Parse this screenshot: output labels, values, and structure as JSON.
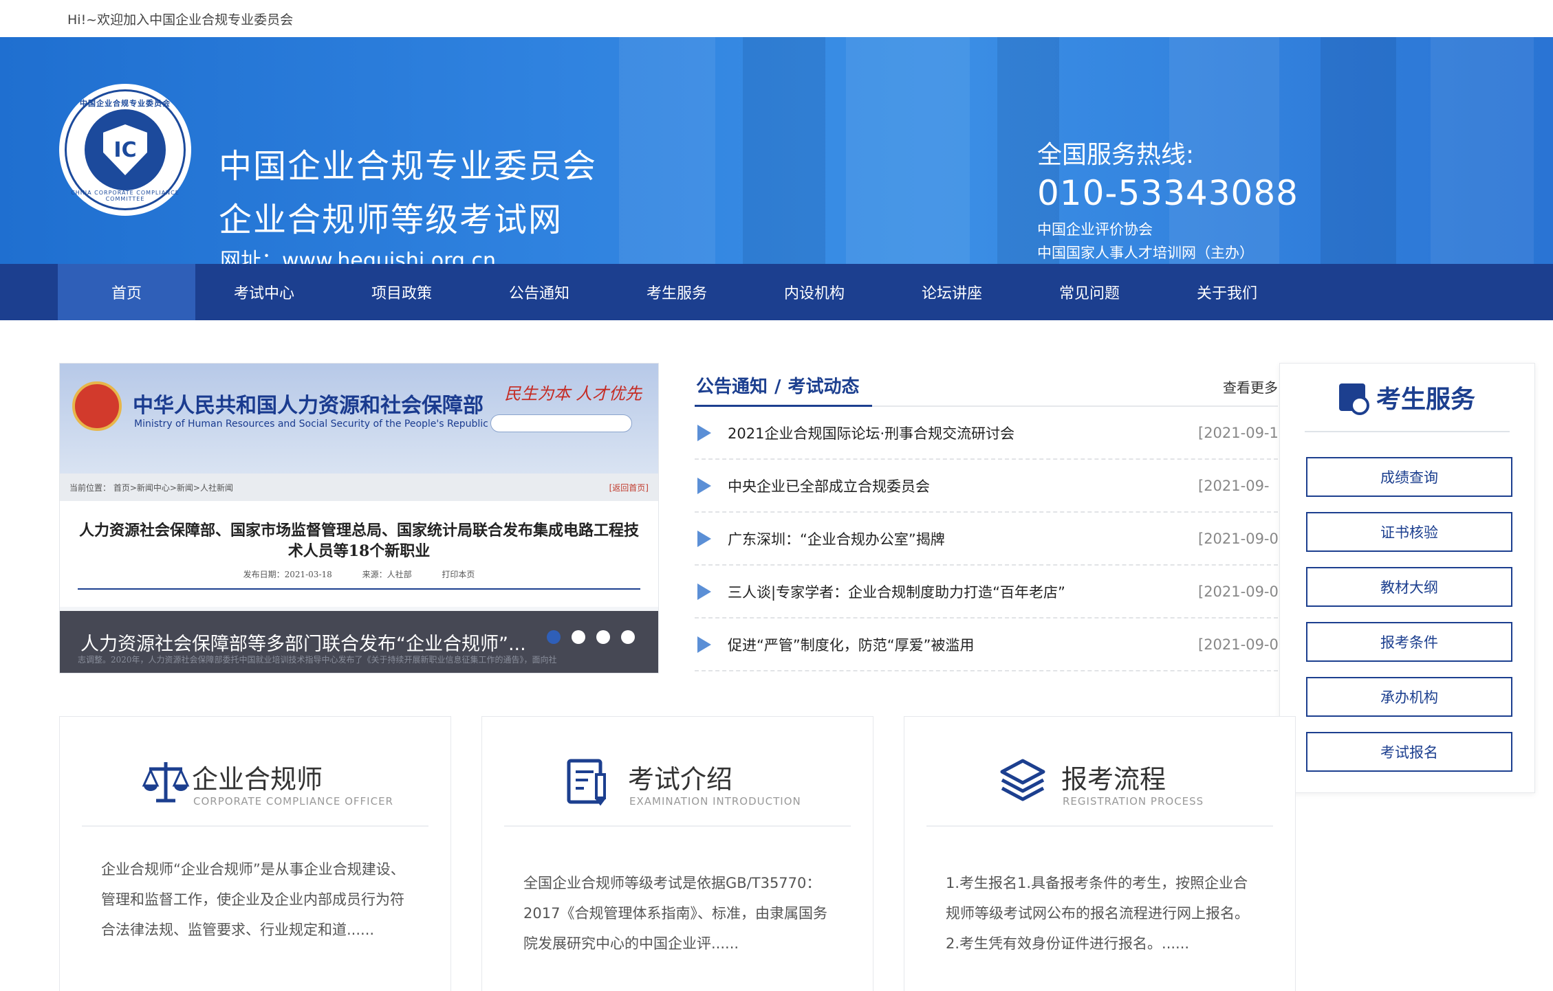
{
  "topbar": {
    "welcome": "Hi!~欢迎加入中国企业合规专业委员会"
  },
  "header": {
    "logo_ring_text": "中国企业合规专业委员会",
    "logo_ring_text_en": "CHINA CORPORATE COMPLIANCE COMMITTEE",
    "logo_mark": "IC",
    "title": "中国企业合规专业委员会",
    "subtitle": "企业合规师等级考试网",
    "url": "网址：www.heguishi.org.cn",
    "hotline_label": "全国服务热线:",
    "hotline_number": "010-53343088",
    "org_line1": "中国企业评价协会",
    "org_line2": "中国国家人事人才培训网（主办）",
    "colors": {
      "nav_bg": "#1c3f8f",
      "nav_active": "#2f5fb8",
      "header_blue": "#2f82df"
    }
  },
  "nav": {
    "items": [
      {
        "label": "首页"
      },
      {
        "label": "考试中心"
      },
      {
        "label": "项目政策"
      },
      {
        "label": "公告通知"
      },
      {
        "label": "考生服务"
      },
      {
        "label": "内设机构"
      },
      {
        "label": "论坛讲座"
      },
      {
        "label": "常见问题"
      },
      {
        "label": "关于我们"
      }
    ]
  },
  "banner": {
    "mohr_cn": "中华人民共和国人力资源和社会保障部",
    "mohr_en": "Ministry of Human Resources and Social Security of the People's Republic of China",
    "calligraphy": "民生为本 人才优先",
    "crumb": "当前位置： 首页>新闻中心>新闻>人社新闻",
    "crumb_back": "[返回首页]",
    "article_title": "人力资源社会保障部、国家市场监督管理总局、国家统计局联合发布集成电路工程技术人员等18个新职业",
    "article_meta": "发布日期：2021-03-18 来源：人社部 打印本页",
    "caption": "人力资源社会保障部等多部门联合发布“企业合规师”...",
    "caption_sub": "志调整。2020年，人力资源社会保障部委托中国就业培训技术指导中心发布了《关于持续开展新职业信息征集工作的通告》，面向社",
    "active_slide": 1,
    "slide_count": 4
  },
  "news": {
    "tab1": "公告通知",
    "separator": "/",
    "tab2": "考试动态",
    "more": "查看更多",
    "items": [
      {
        "title": "2021企业合规国际论坛·刑事合规交流研讨会",
        "date": "[2021-09-1"
      },
      {
        "title": "中央企业已全部成立合规委员会",
        "date": "[2021-09-"
      },
      {
        "title": "广东深圳：“企业合规办公室”揭牌",
        "date": "[2021-09-0"
      },
      {
        "title": "三人谈|专家学者：企业合规制度助力打造“百年老店”",
        "date": "[2021-09-0"
      },
      {
        "title": "促进“严管”制度化，防范“厚爱”被滥用",
        "date": "[2021-09-0"
      }
    ]
  },
  "service": {
    "title": "考生服务",
    "icon": "candidate-service-icon",
    "buttons": [
      "成绩查询",
      "证书核验",
      "教材大纲",
      "报考条件",
      "承办机构",
      "考试报名"
    ]
  },
  "cards": [
    {
      "icon": "scales-icon",
      "title": "企业合规师",
      "en": "CORPORATE COMPLIANCE OFFICER",
      "body": "企业合规师“企业合规师”是从事企业合规建设、管理和监督工作，使企业及企业内部成员行为符合法律法规、监管要求、行业规定和道......"
    },
    {
      "icon": "document-icon",
      "title": "考试介绍",
      "en": "EXAMINATION INTRODUCTION",
      "body": "全国企业合规师等级考试是依据GB/T35770：2017《合规管理体系指南》、标准，由隶属国务院发展研究中心的中国企业评......"
    },
    {
      "icon": "layers-icon",
      "title": "报考流程",
      "en": "REGISTRATION PROCESS",
      "body": "1.考生报名1.具备报考条件的考生，按照企业合规师等级考试网公布的报名流程进行网上报名。2.考生凭有效身份证件进行报名。......"
    }
  ]
}
